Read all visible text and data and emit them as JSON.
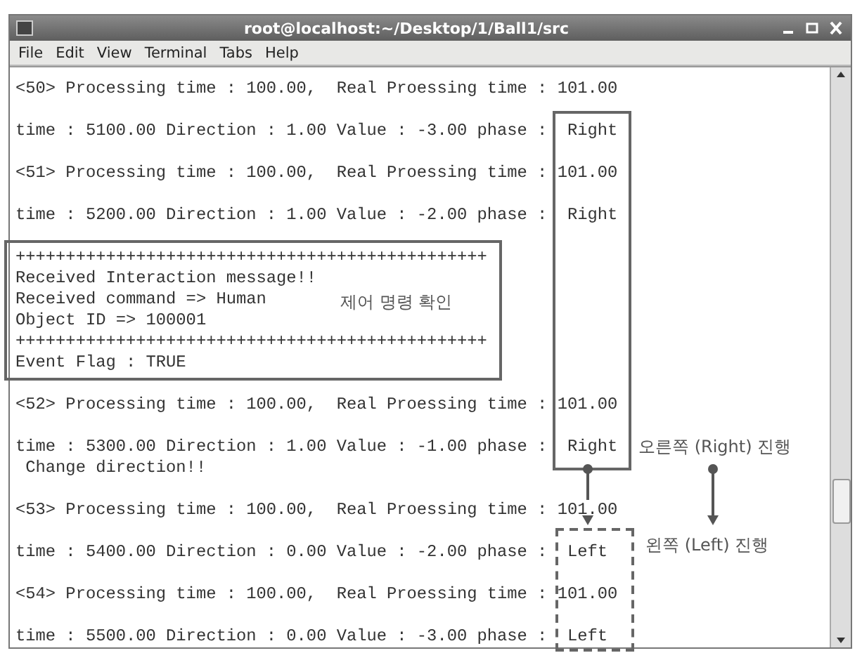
{
  "window": {
    "title": "root@localhost:~/Desktop/1/Ball1/src"
  },
  "menu": [
    {
      "label": "File"
    },
    {
      "label": "Edit"
    },
    {
      "label": "View"
    },
    {
      "label": "Terminal"
    },
    {
      "label": "Tabs"
    },
    {
      "label": "Help"
    }
  ],
  "terminal": {
    "blocks": [
      {
        "lines": [
          "<50> Processing time : 100.00,  Real Proessing time : 101.00"
        ]
      },
      {
        "lines": [
          "time : 5100.00 Direction : 1.00 Value : -3.00 phase :  Right"
        ]
      },
      {
        "lines": [
          "<51> Processing time : 100.00,  Real Proessing time : 101.00"
        ]
      },
      {
        "lines": [
          "time : 5200.00 Direction : 1.00 Value : -2.00 phase :  Right"
        ]
      },
      {
        "lines": [
          "+++++++++++++++++++++++++++++++++++++++++++++++",
          "Received Interaction message!!",
          "Received command => Human",
          "Object ID => 100001",
          "+++++++++++++++++++++++++++++++++++++++++++++++",
          "Event Flag : TRUE"
        ]
      },
      {
        "lines": [
          "<52> Processing time : 100.00,  Real Proessing time : 101.00"
        ]
      },
      {
        "lines": [
          "time : 5300.00 Direction : 1.00 Value : -1.00 phase :  Right",
          " Change direction!!"
        ]
      },
      {
        "lines": [
          "<53> Processing time : 100.00,  Real Proessing time : 101.00"
        ]
      },
      {
        "lines": [
          "time : 5400.00 Direction : 0.00 Value : -2.00 phase :  Left"
        ]
      },
      {
        "lines": [
          "<54> Processing time : 100.00,  Real Proessing time : 101.00"
        ]
      },
      {
        "lines": [
          "time : 5500.00 Direction : 0.00 Value : -3.00 phase :  Left"
        ]
      }
    ]
  },
  "annotations": {
    "command_label": "제어 명령 확인",
    "right_label": "오른쪽 (Right) 진행",
    "left_label": "왼쪽 (Left) 진행"
  }
}
